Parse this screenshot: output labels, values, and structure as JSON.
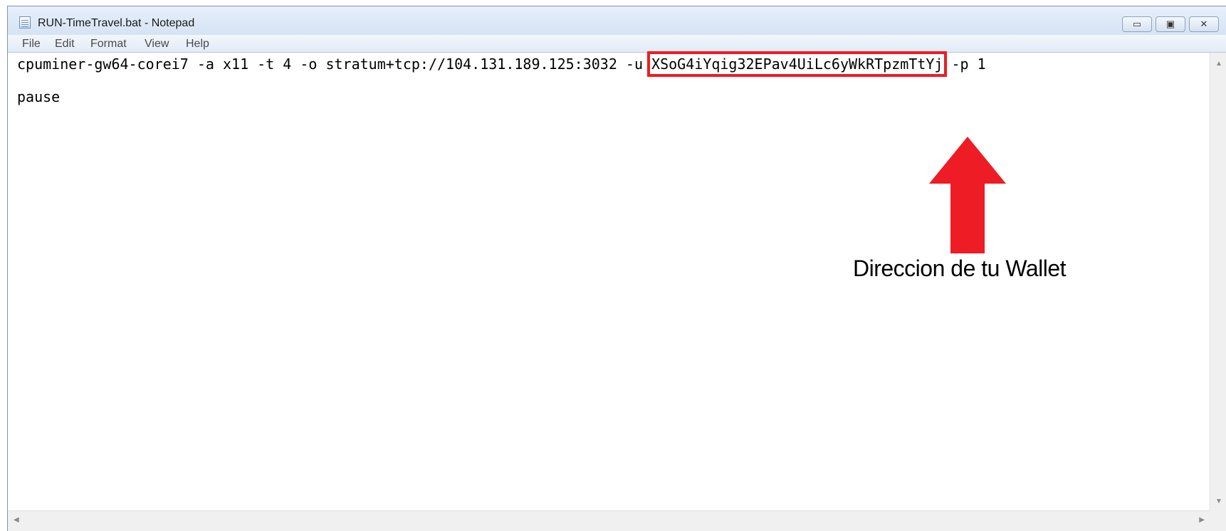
{
  "window": {
    "title": "RUN-TimeTravel.bat - Notepad",
    "controls": {
      "minimize": "▭",
      "maximize": "▣",
      "close": "✕"
    }
  },
  "menu": {
    "file": "File",
    "edit": "Edit",
    "format": "Format",
    "view": "View",
    "help": "Help"
  },
  "editor": {
    "line1": {
      "before": "cpuminer-gw64-corei7 -a x11 -t 4 -o stratum+tcp://104.131.189.125:3032 -u ",
      "wallet": "XSoG4iYqig32EPav4UiLc6yWkRTpzmTtYj",
      "after": " -p 1"
    },
    "line2": "pause"
  },
  "annotation": {
    "label": "Direccion de tu Wallet",
    "color": "#ee1c24"
  },
  "colors": {
    "highlight": "#ee1c24",
    "titlebar": "#dfe9f5"
  }
}
